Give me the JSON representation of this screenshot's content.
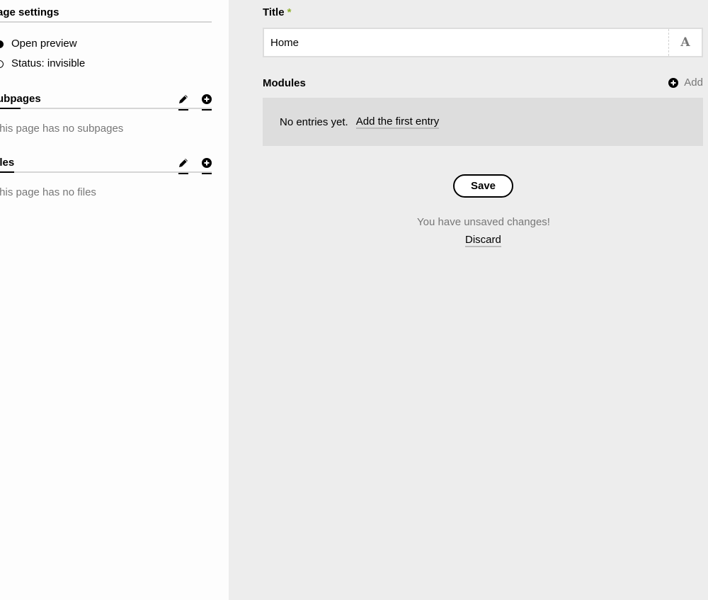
{
  "sidebar": {
    "page_settings": {
      "title": "Page settings",
      "items": [
        {
          "label": "Open preview",
          "filled": true
        },
        {
          "label": "Status: invisible",
          "filled": false
        }
      ]
    },
    "subpages": {
      "title": "Subpages",
      "empty": "This page has no subpages"
    },
    "files": {
      "title": "Files",
      "empty": "This page has no files"
    }
  },
  "main": {
    "title_field": {
      "label": "Title",
      "required_marker": "*",
      "value": "Home",
      "font_icon": "A"
    },
    "modules": {
      "label": "Modules",
      "add_label": "Add",
      "empty_text": "No entries yet.",
      "add_first_label": "Add the first entry"
    },
    "save_label": "Save",
    "unsaved_message": "You have unsaved changes!",
    "discard_label": "Discard"
  },
  "colors": {
    "required_marker": "#8dae28",
    "muted_text": "#777777",
    "panel_bg": "#ededed",
    "empty_box_bg": "#dddddd"
  }
}
